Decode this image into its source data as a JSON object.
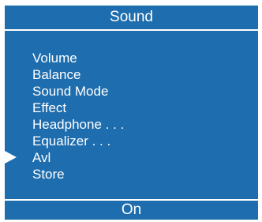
{
  "menu": {
    "title": "Sound",
    "items": [
      {
        "label": "Volume"
      },
      {
        "label": "Balance"
      },
      {
        "label": "Sound Mode"
      },
      {
        "label": "Effect"
      },
      {
        "label": "Headphone . . ."
      },
      {
        "label": "Equalizer . . ."
      },
      {
        "label": "Avl"
      },
      {
        "label": "Store"
      }
    ],
    "selected_index": 6,
    "selected_value": "On"
  },
  "colors": {
    "background": "#1e6dae",
    "text": "#ffffff"
  },
  "icons": {
    "pointer": "play-arrow-icon"
  }
}
